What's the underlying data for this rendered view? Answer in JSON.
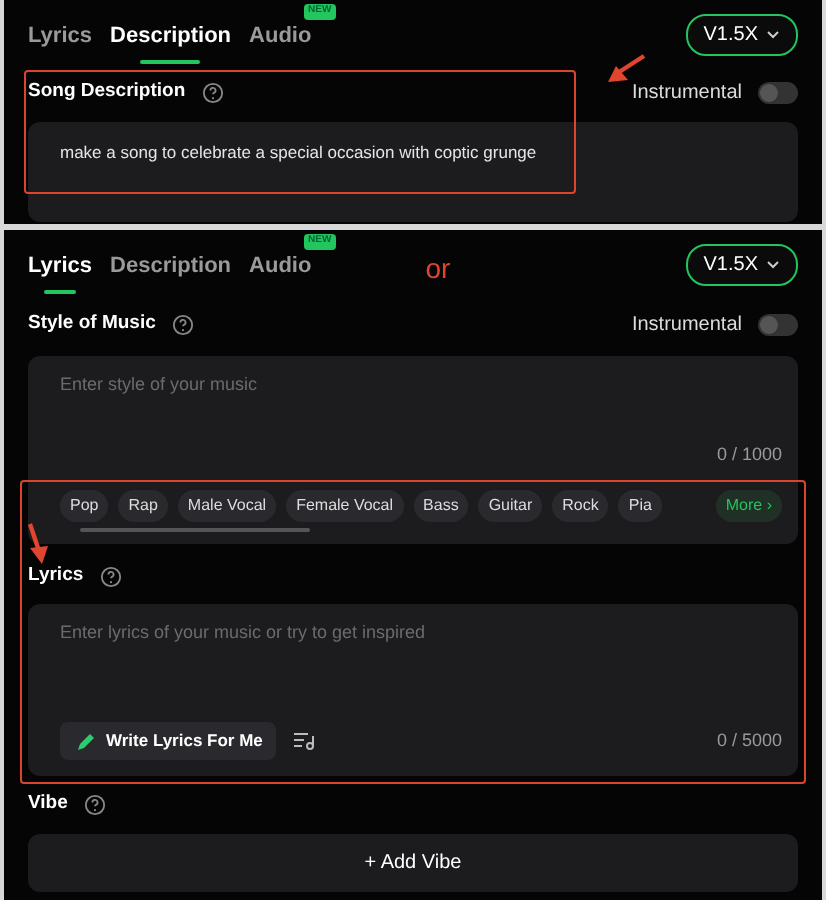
{
  "panels": [
    {
      "tabs": [
        {
          "label": "Lyrics",
          "selected": false
        },
        {
          "label": "Description",
          "selected": true
        },
        {
          "label": "Audio",
          "selected": false,
          "badge": "NEW"
        }
      ],
      "version": "V1.5X",
      "instrumental": {
        "label": "Instrumental",
        "on": false
      },
      "fields": [
        {
          "kind": "description",
          "label": "Song Description",
          "value": "make a song to celebrate a special occasion with coptic grunge",
          "highlighted": true
        }
      ]
    },
    {
      "tabs": [
        {
          "label": "Lyrics",
          "selected": true
        },
        {
          "label": "Description",
          "selected": false
        },
        {
          "label": "Audio",
          "selected": false,
          "badge": "NEW"
        }
      ],
      "version": "V1.5X",
      "note": "or",
      "instrumental": {
        "label": "Instrumental",
        "on": false
      },
      "fields": [
        {
          "kind": "style",
          "label": "Style of Music",
          "placeholder": "Enter style of your music",
          "counter": "0 / 1000",
          "chips": [
            "Pop",
            "Rap",
            "Male Vocal",
            "Female Vocal",
            "Bass",
            "Guitar",
            "Rock",
            "Pia"
          ],
          "more": "More ›",
          "highlighted": false
        },
        {
          "kind": "lyrics",
          "label": "Lyrics",
          "placeholder": "Enter lyrics of your music or try to get inspired",
          "counter": "0 / 5000",
          "button": "Write Lyrics For Me",
          "highlighted": true
        },
        {
          "kind": "vibe",
          "label": "Vibe",
          "button": "+ Add Vibe",
          "highlighted": false
        }
      ]
    }
  ]
}
